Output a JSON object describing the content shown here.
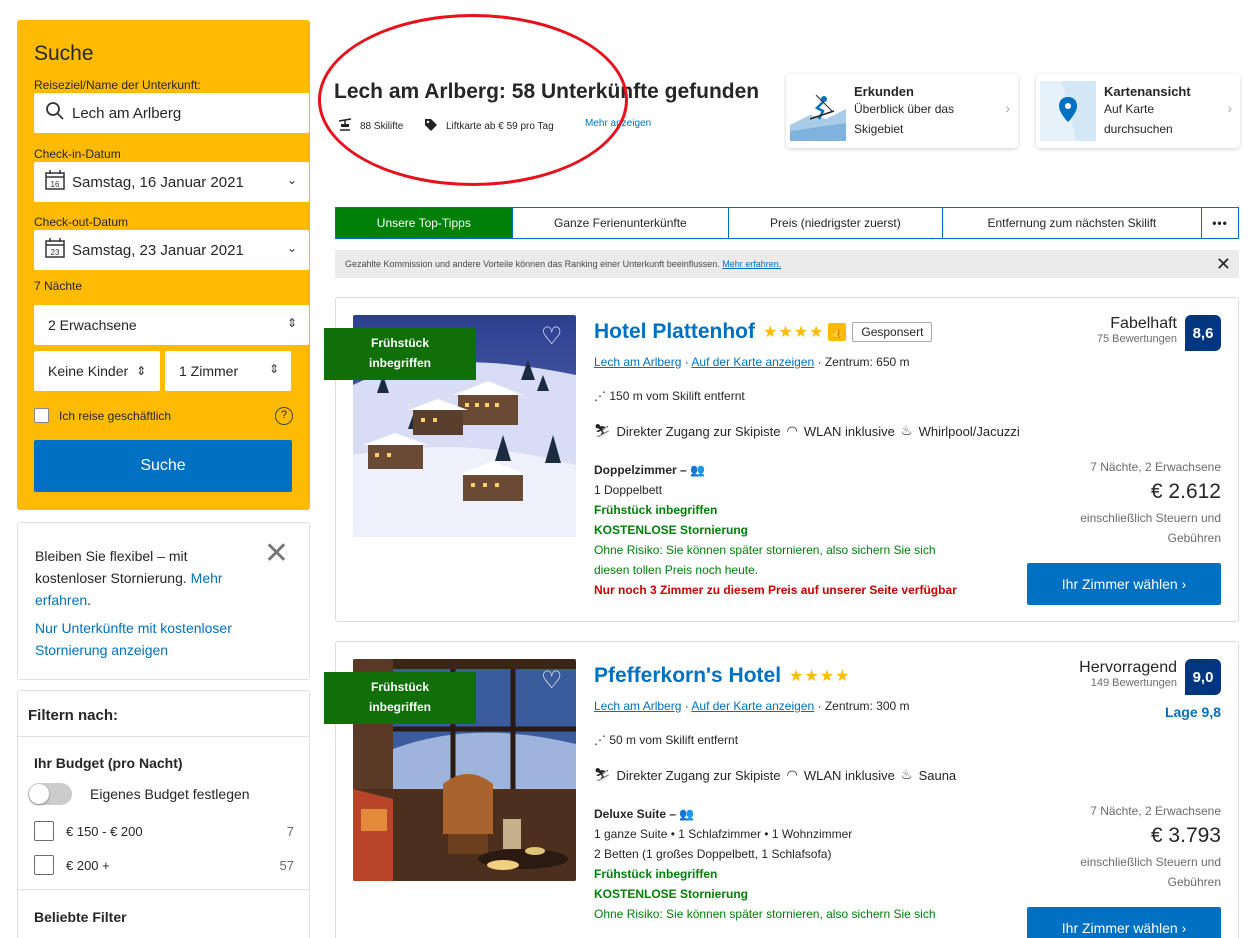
{
  "search": {
    "title": "Suche",
    "destination_label": "Reiseziel/Name der Unterkunft:",
    "destination_value": "Lech am Arlberg",
    "checkin_label": "Check-in-Datum",
    "checkin_value": "Samstag, 16 Januar 2021",
    "checkin_day": "16",
    "checkout_label": "Check-out-Datum",
    "checkout_value": "Samstag, 23 Januar 2021",
    "checkout_day": "23",
    "nights": "7 Nächte",
    "adults": "2 Erwachsene",
    "children": "Keine Kinder",
    "rooms": "1 Zimmer",
    "business_label": "Ich reise geschäftlich",
    "help": "?",
    "button": "Suche"
  },
  "flex": {
    "text": "Bleiben Sie flexibel – mit kostenloser Stornierung.",
    "link": "Mehr erfahren",
    "link_suffix": ".",
    "filter_link": "Nur Unterkünfte mit kostenloser Stornierung anzeigen",
    "close": "✕"
  },
  "filters": {
    "title": "Filtern nach:",
    "budget_title": "Ihr Budget (pro Nacht)",
    "custom_budget": "Eigenes Budget festlegen",
    "budget_options": [
      {
        "label": "€ 150 - € 200",
        "count": "7"
      },
      {
        "label": "€ 200 +",
        "count": "57"
      }
    ],
    "popular_title": "Beliebte Filter"
  },
  "header": {
    "title": "Lech am Arlberg: 58 Unterkünfte gefunden",
    "lifts": "88 Skilifte",
    "skipass": "Liftkarte ab € 59 pro Tag",
    "more": "Mehr anzeigen"
  },
  "explore": {
    "title": "Erkunden",
    "desc": "Überblick über das Skigebiet"
  },
  "map": {
    "title": "Kartenansicht",
    "desc": "Auf Karte durchsuchen"
  },
  "tabs": [
    "Unsere Top-Tipps",
    "Ganze Ferienunterkünfte",
    "Preis (niedrigster zuerst)",
    "Entfernung zum nächsten Skilift",
    "•••"
  ],
  "notice": {
    "text": "Gezahlte Kommission und andere Vorteile können das Ranking einer Unterkunft beeinflussen.",
    "link": "Mehr erfahren.",
    "close": "✕"
  },
  "properties": [
    {
      "ribbon": "Frühstück inbegriffen",
      "name": "Hotel Plattenhof",
      "stars": "★★★★",
      "sponsored": "Gesponsert",
      "town": "Lech am Arlberg",
      "map_link": "Auf der Karte anzeigen",
      "center": "Zentrum: 650 m",
      "lift": "150 m vom Skilift entfernt",
      "amenities": [
        "Direkter Zugang zur Skipiste",
        "WLAN inklusive",
        "Whirlpool/Jacuzzi"
      ],
      "room_type": "Doppelzimmer",
      "beds": "1 Doppelbett",
      "beds2": "",
      "breakfast": "Frühstück inbegriffen",
      "cancel": "KOSTENLOSE Stornierung",
      "risk": "Ohne Risiko: Sie können später stornieren, also sichern Sie sich diesen tollen Preis noch heute.",
      "scarcity": "Nur noch 3 Zimmer zu diesem Preis auf unserer Seite verfügbar",
      "score_word": "Fabelhaft",
      "reviews": "75 Bewertungen",
      "score": "8,6",
      "location_score": "",
      "stay": "7 Nächte, 2 Erwachsene",
      "price": "€ 2.612",
      "tax": "einschließlich Steuern und Gebühren",
      "button": "Ihr Zimmer wählen  ›"
    },
    {
      "ribbon": "Frühstück inbegriffen",
      "name": "Pfefferkorn's Hotel",
      "stars": "★★★★",
      "town": "Lech am Arlberg",
      "map_link": "Auf der Karte anzeigen",
      "center": "Zentrum: 300 m",
      "lift": "50 m vom Skilift entfernt",
      "amenities": [
        "Direkter Zugang zur Skipiste",
        "WLAN inklusive",
        "Sauna"
      ],
      "room_type": "Deluxe Suite",
      "beds": "1 ganze Suite • 1 Schlafzimmer • 1 Wohnzimmer",
      "beds2": "2 Betten (1 großes Doppelbett, 1 Schlafsofa)",
      "breakfast": "Frühstück inbegriffen",
      "cancel": "KOSTENLOSE Stornierung",
      "risk": "Ohne Risiko: Sie können später stornieren, also sichern Sie sich",
      "score_word": "Hervorragend",
      "reviews": "149 Bewertungen",
      "score": "9,0",
      "location_score": "Lage 9,8",
      "stay": "7 Nächte, 2 Erwachsene",
      "price": "€ 3.793",
      "tax": "einschließlich Steuern und Gebühren",
      "button": "Ihr Zimmer wählen  ›"
    }
  ],
  "colors": {
    "brand_blue": "#0071c2",
    "search_yellow": "#febb02",
    "green": "#008009",
    "score_navy": "#003580",
    "annotation_red": "#e8101b"
  }
}
